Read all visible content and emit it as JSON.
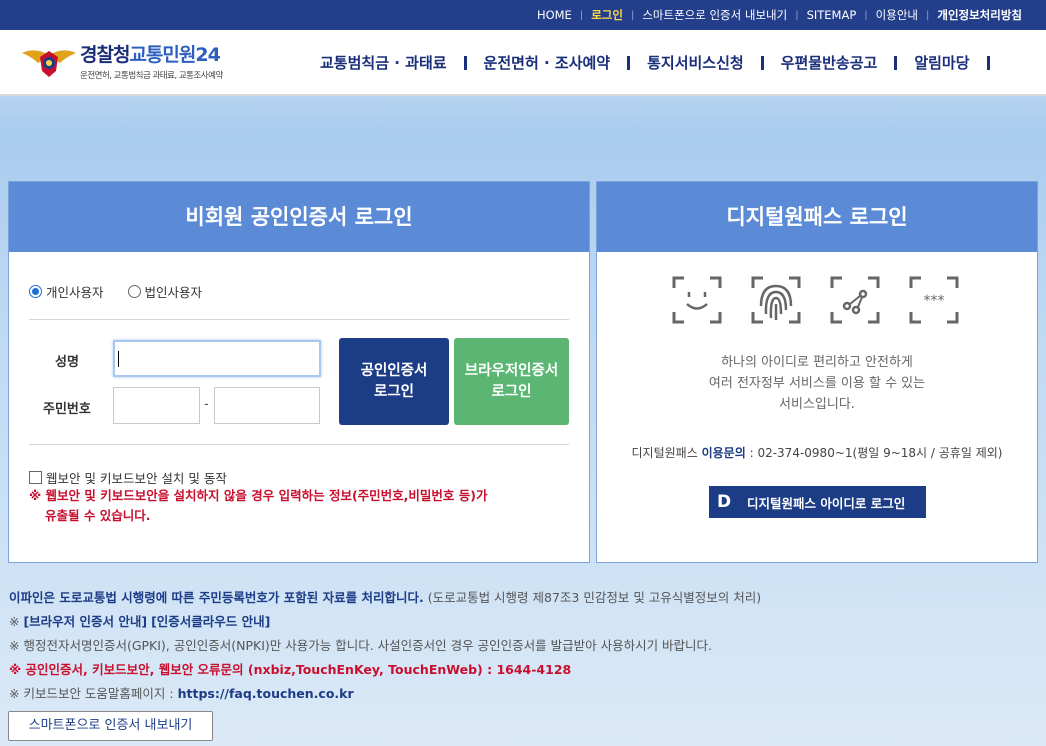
{
  "top_nav": {
    "home": "HOME",
    "login": "로그인",
    "smartphone_export": "스마트폰으로 인증서 내보내기",
    "sitemap": "SITEMAP",
    "guide": "이용안내",
    "privacy": "개인정보처리방침"
  },
  "logo": {
    "title_part1": "경찰청",
    "title_part2": "교통민원24",
    "subtitle": "운전면허, 교통범칙금 과태료, 교통조사예약"
  },
  "main_nav": {
    "items": [
      {
        "label": "교통범칙금 · 과태료"
      },
      {
        "label": "운전면허 · 조사예약"
      },
      {
        "label": "통지서비스신청"
      },
      {
        "label": "우편물반송공고"
      },
      {
        "label": "알림마당"
      }
    ]
  },
  "cert_login": {
    "title": "비회원 공인인증서 로그인",
    "radio_personal": "개인사용자",
    "radio_corporate": "법인사용자",
    "selected": "개인사용자",
    "name_label": "성명",
    "rrn_label": "주민번호",
    "dash": "-",
    "cert_button_line1": "공인인증서",
    "cert_button_line2": "로그인",
    "browser_button_line1": "브라우저인증서",
    "browser_button_line2": "로그인",
    "security_checkbox": "웹보안 및 키보드보안 설치 및 동작",
    "warning": "※ 웹보안 및 키보드보안을 설치하지 않을 경우 입력하는 정보(주민번호,비밀번호 등)가",
    "warning_line2": "유출될 수 있습니다."
  },
  "digital_onepass": {
    "title": "디지털원패스 로그인",
    "icons": [
      "face-recognition-icon",
      "fingerprint-icon",
      "pattern-icon",
      "password-icon"
    ],
    "desc_line1": "하나의 아이디로 편리하고 안전하게",
    "desc_line2": "여러 전자정부 서비스를 이용 할 수 있는",
    "desc_line3": "서비스입니다.",
    "contact_prefix": "디지털원패스",
    "contact_highlight": "이용문의",
    "contact_rest": ": 02-374-0980~1(평일 9~18시 / 공휴일 제외)",
    "button_logo": "D",
    "button_label": "디지털원패스 아이디로 로그인"
  },
  "notes": {
    "line1_bold": "이파인은 도로교통법 시행령에 따른 주민등록번호가 포함된 자료를 처리합니다.",
    "line1_rest": "(도로교통법 시행령 제87조3 민감정보 및 고유식별정보의 처리)",
    "line2_prefix": "※",
    "line2_link1": "[브라우저 인증서 안내]",
    "line2_link2": "[인증서클라우드 안내]",
    "line3": "※ 행정전자서명인증서(GPKI), 공인인증서(NPKI)만 사용가능 합니다. 사설인증서인 경우 공인인증서를 발급받아 사용하시기 바랍니다.",
    "line4": "※ 공인인증서, 키보드보안, 웹보안 오류문의 (nxbiz,TouchEnKey, TouchEnWeb) : 1644-4128",
    "line5_prefix": "※ 키보드보안 도움말홈페이지 :",
    "line5_link": "https://faq.touchen.co.kr"
  },
  "export_button": "스마트폰으로 인증서 내보내기",
  "colors": {
    "topbar": "#233f8c",
    "panel_header": "#5b8bd6",
    "cert_button": "#1c3c86",
    "browser_button": "#5bb673",
    "warning": "#c8102e",
    "active_top_link": "#ffd84a"
  }
}
